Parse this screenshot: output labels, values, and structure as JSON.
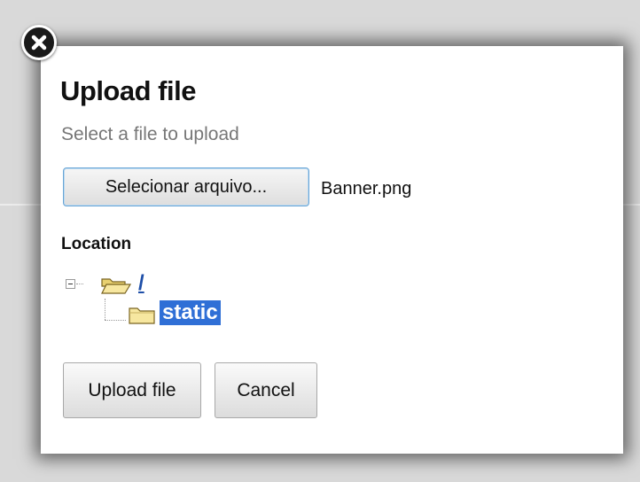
{
  "dialog": {
    "title": "Upload file",
    "subtitle": "Select a file to upload"
  },
  "file_input": {
    "button_label": "Selecionar arquivo...",
    "selected_file": "Banner.png"
  },
  "location": {
    "label": "Location",
    "tree": [
      {
        "label": "/",
        "expanded": true,
        "icon": "folder-open-icon",
        "underlined": true
      },
      {
        "label": "static",
        "selected": true,
        "icon": "folder-icon"
      }
    ]
  },
  "actions": {
    "upload_label": "Upload file",
    "cancel_label": "Cancel"
  },
  "colors": {
    "selection": "#2f6fd6",
    "link": "#1e4fa8",
    "title": "#111111",
    "subtitle": "#777777"
  }
}
